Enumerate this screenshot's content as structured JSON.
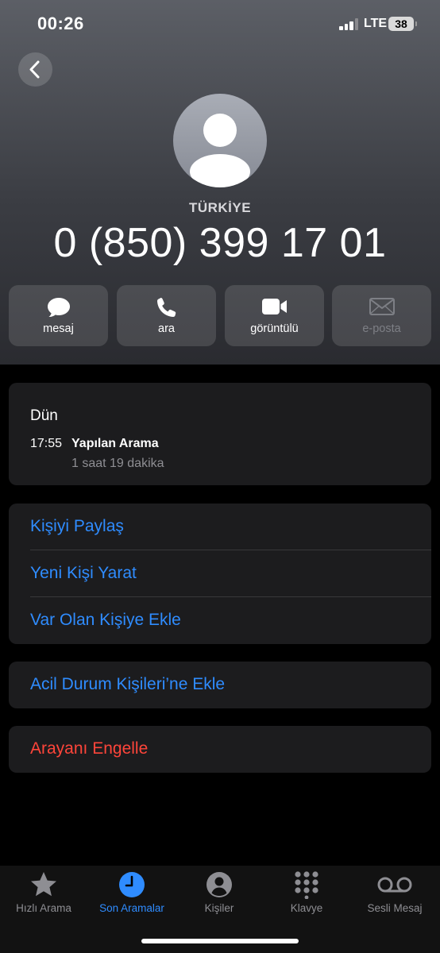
{
  "status_bar": {
    "time": "00:26",
    "network": "LTE",
    "battery": "38"
  },
  "contact": {
    "country": "TÜRKİYE",
    "number": "0 (850) 399 17 01"
  },
  "actions": [
    {
      "label": "mesaj",
      "icon": "message-icon"
    },
    {
      "label": "ara",
      "icon": "phone-icon"
    },
    {
      "label": "görüntülü",
      "icon": "video-icon"
    },
    {
      "label": "e-posta",
      "icon": "mail-icon"
    }
  ],
  "history": {
    "day": "Dün",
    "time": "17:55",
    "type": "Yapılan Arama",
    "duration": "1 saat 19 dakika"
  },
  "options": {
    "share": "Kişiyi Paylaş",
    "new_contact": "Yeni Kişi Yarat",
    "add_existing": "Var Olan Kişiye Ekle",
    "emergency": "Acil Durum Kişileri’ne Ekle",
    "block": "Arayanı Engelle"
  },
  "tabs": [
    {
      "label": "Hızlı Arama",
      "icon": "star-icon"
    },
    {
      "label": "Son Aramalar",
      "icon": "clock-icon",
      "active": true
    },
    {
      "label": "Kişiler",
      "icon": "person-circle-icon"
    },
    {
      "label": "Klavye",
      "icon": "keypad-icon"
    },
    {
      "label": "Sesli Mesaj",
      "icon": "voicemail-icon"
    }
  ],
  "colors": {
    "accent": "#2f8cff",
    "destructive": "#ff453a",
    "card": "#1c1c1e"
  }
}
